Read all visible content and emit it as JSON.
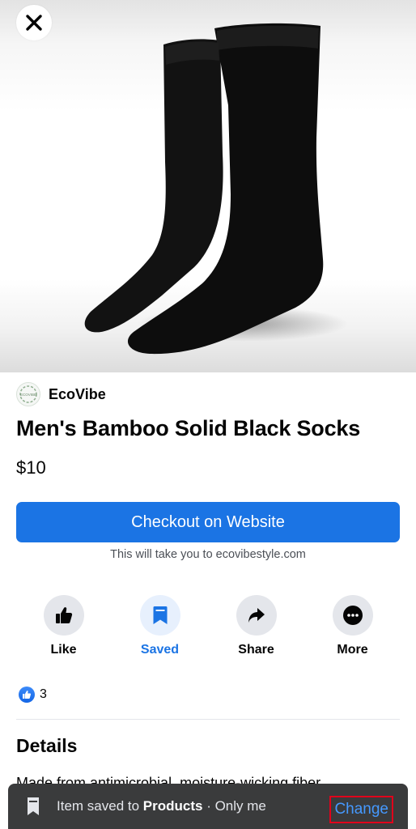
{
  "product": {
    "seller_name": "EcoVibe",
    "seller_logo_text": "ECOVIBE",
    "title": "Men's Bamboo Solid Black Socks",
    "price": "$10"
  },
  "checkout": {
    "button_label": "Checkout on Website",
    "note": "This will take you to ecovibestyle.com"
  },
  "actions": [
    {
      "label": "Like",
      "icon": "thumbs-up-icon",
      "active": false
    },
    {
      "label": "Saved",
      "icon": "bookmark-icon",
      "active": true
    },
    {
      "label": "Share",
      "icon": "share-arrow-icon",
      "active": false
    },
    {
      "label": "More",
      "icon": "more-dots-icon",
      "active": false
    }
  ],
  "reactions": {
    "count": "3",
    "icon": "like-reaction-icon"
  },
  "details": {
    "heading": "Details",
    "text": "Made from antimicrobial, moisture-wicking fiber"
  },
  "toast": {
    "prefix": "Item saved to ",
    "collection": "Products",
    "suffix": " · Only me",
    "action_label": "Change"
  },
  "colors": {
    "accent": "#1b74e4",
    "toast_background": "#3a3b3c",
    "highlight_border": "#e0001b"
  }
}
